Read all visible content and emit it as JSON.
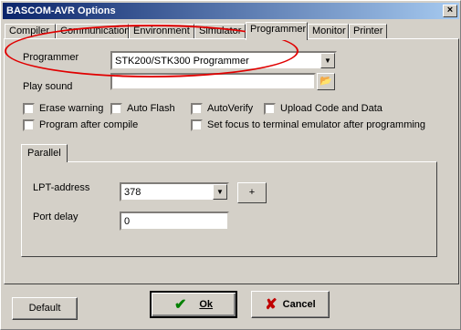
{
  "window": {
    "title": "BASCOM-AVR Options",
    "close_glyph": "×"
  },
  "tabs": [
    {
      "label": "Compiler",
      "active": false
    },
    {
      "label": "Communication",
      "active": false
    },
    {
      "label": "Environment",
      "active": false
    },
    {
      "label": "Simulator",
      "active": false
    },
    {
      "label": "Programmer",
      "active": true
    },
    {
      "label": "Monitor",
      "active": false
    },
    {
      "label": "Printer",
      "active": false
    }
  ],
  "programmer": {
    "label": "Programmer",
    "value": "STK200/STK300 Programmer",
    "dropdown_glyph": "▼"
  },
  "play_sound": {
    "label": "Play sound",
    "value": "",
    "browse_glyph": "📂"
  },
  "checkboxes": [
    {
      "label": "Erase warning",
      "checked": false
    },
    {
      "label": "Auto Flash",
      "checked": false
    },
    {
      "label": "AutoVerify",
      "checked": false
    },
    {
      "label": "Upload Code and Data",
      "checked": false
    },
    {
      "label": "Program after compile",
      "checked": false
    },
    {
      "label": "Set focus to terminal emulator after programming",
      "checked": false
    }
  ],
  "parallel": {
    "tab_label": "Parallel",
    "lpt_label": "LPT-address",
    "lpt_value": "378",
    "plus_label": "+",
    "port_delay_label": "Port delay",
    "port_delay_value": "0"
  },
  "buttons": {
    "default": "Default",
    "ok": "Ok",
    "ok_glyph": "✔",
    "cancel": "Cancel",
    "cancel_glyph": "✘"
  },
  "colors": {
    "highlight_ellipse": "#e00000",
    "ok_icon": "#008000",
    "cancel_icon": "#c00000"
  }
}
